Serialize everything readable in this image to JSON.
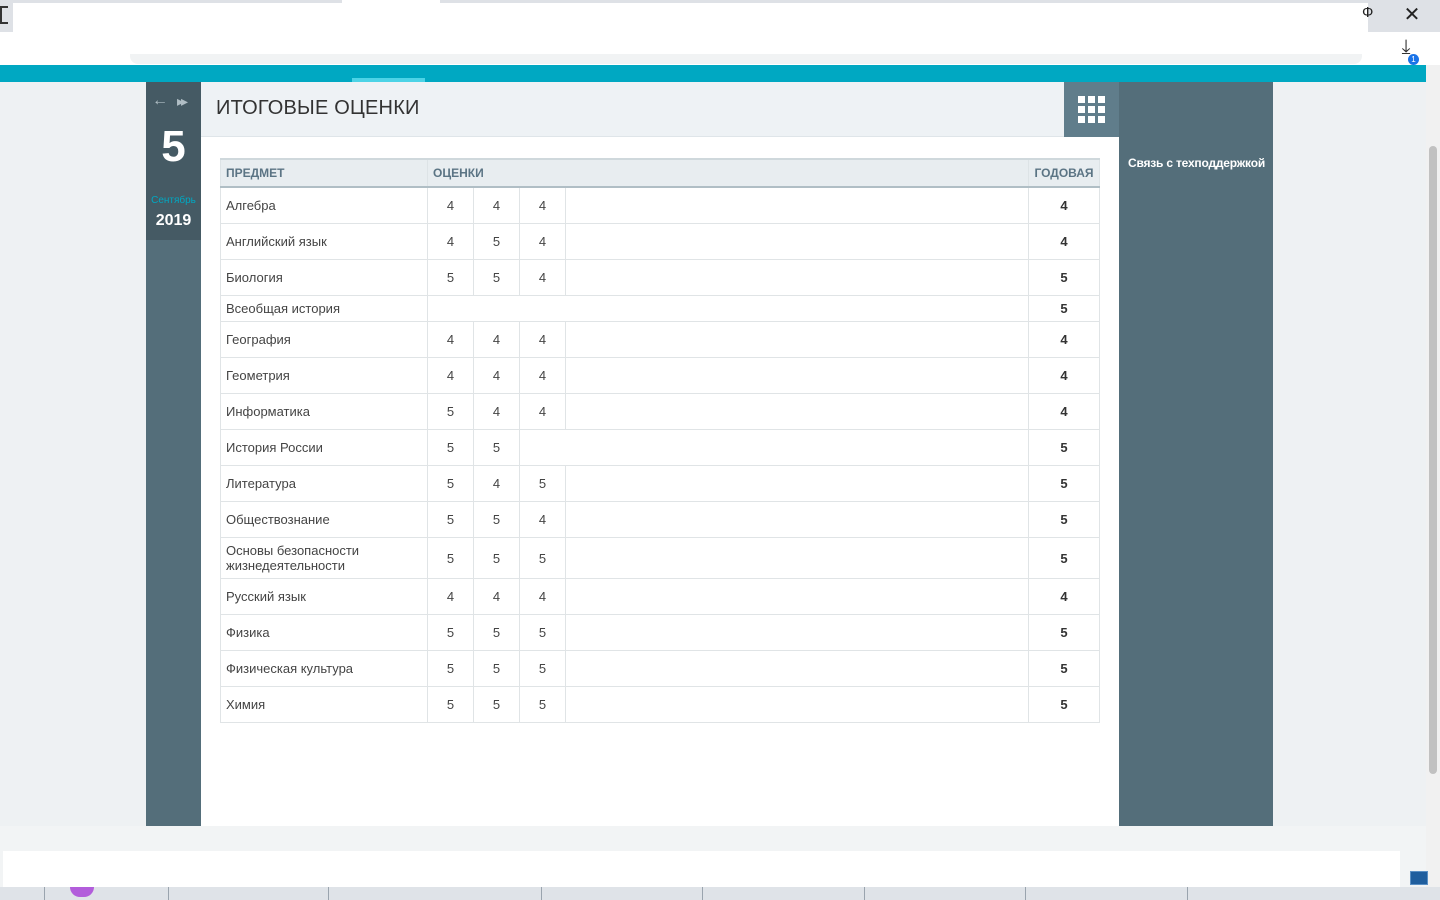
{
  "browser": {
    "close_symbol": "✕",
    "minimize_symbol": "Ф",
    "download_symbol": "⤓",
    "download_count": "1"
  },
  "date_panel": {
    "prev_icon": "arrow-left-icon",
    "next_icon": "fast-forward-icon",
    "day": "5",
    "month": "Сентябрь",
    "year": "2019"
  },
  "page": {
    "title": "ИТОГОВЫЕ ОЦЕНКИ"
  },
  "sidebar": {
    "support_link": "Связь с техподдержкой"
  },
  "table": {
    "headers": {
      "subject": "ПРЕДМЕТ",
      "marks": "ОЦЕНКИ",
      "year": "ГОДОВАЯ"
    },
    "rows": [
      {
        "subject": "Алгебра",
        "marks": [
          "4",
          "4",
          "4"
        ],
        "year": "4"
      },
      {
        "subject": "Английский язык",
        "marks": [
          "4",
          "5",
          "4"
        ],
        "year": "4"
      },
      {
        "subject": "Биология",
        "marks": [
          "5",
          "5",
          "4"
        ],
        "year": "5"
      },
      {
        "subject": "Всеобщая история",
        "marks": [],
        "year": "5"
      },
      {
        "subject": "География",
        "marks": [
          "4",
          "4",
          "4"
        ],
        "year": "4"
      },
      {
        "subject": "Геометрия",
        "marks": [
          "4",
          "4",
          "4"
        ],
        "year": "4"
      },
      {
        "subject": "Информатика",
        "marks": [
          "5",
          "4",
          "4"
        ],
        "year": "4"
      },
      {
        "subject": "История России",
        "marks": [
          "5",
          "5"
        ],
        "year": "5"
      },
      {
        "subject": "Литература",
        "marks": [
          "5",
          "4",
          "5"
        ],
        "year": "5"
      },
      {
        "subject": "Обществознание",
        "marks": [
          "5",
          "5",
          "4"
        ],
        "year": "5"
      },
      {
        "subject": "Основы безопасности жизнедеятельности",
        "marks": [
          "5",
          "5",
          "5"
        ],
        "year": "5"
      },
      {
        "subject": "Русский язык",
        "marks": [
          "4",
          "4",
          "4"
        ],
        "year": "4"
      },
      {
        "subject": "Физика",
        "marks": [
          "5",
          "5",
          "5"
        ],
        "year": "5"
      },
      {
        "subject": "Физическая культура",
        "marks": [
          "5",
          "5",
          "5"
        ],
        "year": "5"
      },
      {
        "subject": "Химия",
        "marks": [
          "5",
          "5",
          "5"
        ],
        "year": "5"
      }
    ]
  },
  "colors": {
    "header_accent": "#00a8c2",
    "panel_dark": "#546e7a",
    "apps_button": "#607d8b"
  }
}
